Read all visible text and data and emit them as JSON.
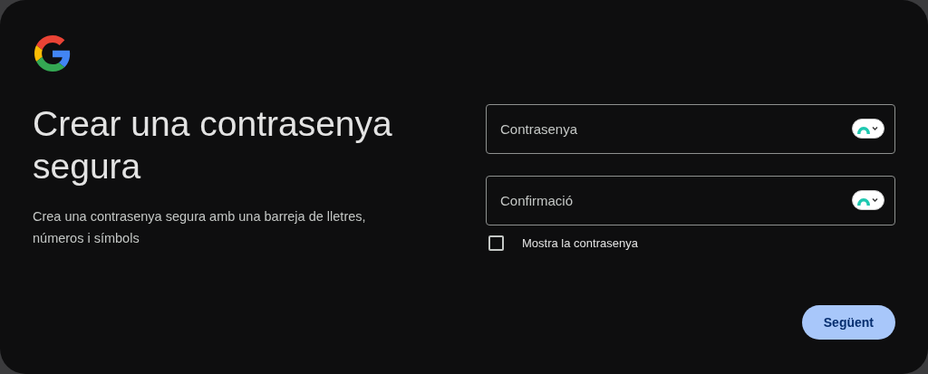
{
  "heading": "Crear una contrasenya segura",
  "description": "Crea una contrasenya segura amb una barreja de lletres, números i símbols",
  "fields": [
    {
      "placeholder": "Contrasenya"
    },
    {
      "placeholder": "Confirmació"
    }
  ],
  "show_password": {
    "label": "Mostra la contrasenya",
    "checked": false
  },
  "buttons": [
    "Següent"
  ]
}
